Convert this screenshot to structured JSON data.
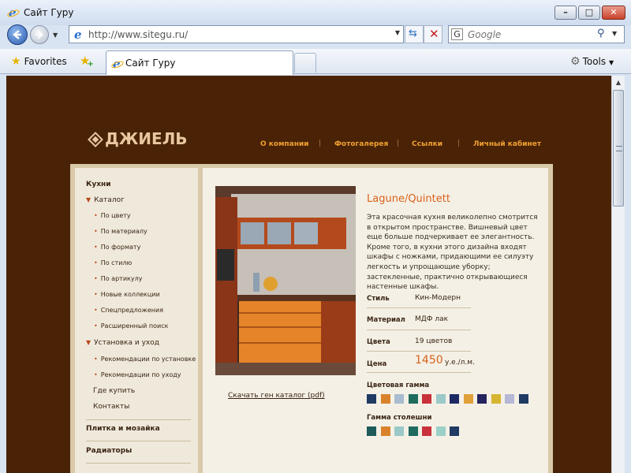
{
  "window": {
    "title": "Сайт Гуру"
  },
  "navigation": {
    "address": "http://www.sitegu.ru/",
    "search_placeholder": "Google",
    "search_engine_letter": "G"
  },
  "toolbar": {
    "favorites_label": "Favorites",
    "tab_title": "Сайт Гуру",
    "tools_label": "Tools"
  },
  "site": {
    "logo_text": "ДЖИЕЛЬ",
    "top_nav": [
      "О компании",
      "Фотогалерея",
      "Ссылки",
      "Личный кабинет"
    ]
  },
  "sidebar": {
    "section_title": "Кухни",
    "catalog_label": "Каталог",
    "catalog_items": [
      "По цвету",
      "По материалу",
      "По формату",
      "По стилю",
      "По артикулу",
      "Новые коллекции",
      "Спецпредложения",
      "Расширенный поиск"
    ],
    "install_label": "Установка и уход",
    "install_items": [
      "Рекомендации по установке",
      "Рекомендации по уходу"
    ],
    "plain_items": [
      "Где купить",
      "Контакты"
    ],
    "other_sections": [
      "Плитка и мозайка",
      "Радиаторы"
    ]
  },
  "product": {
    "title": "Lagune/Quintett",
    "description": "Эта красочная кухня великолепно смотрится в открытом пространстве. Вишневый цвет еще больше подчеркивает ее элегантность. Кроме того, в кухни этого дизайна входят шкафы с ножками, придающими ее силуэту легкость и упрощающие уборку; застекленные, практично открывающиеся настенные шкафы.",
    "specs": [
      {
        "label": "Стиль",
        "value": "Кин-Модерн"
      },
      {
        "label": "Материал",
        "value": "МДФ лак"
      },
      {
        "label": "Цвета",
        "value": "19 цветов"
      }
    ],
    "price_label": "Цена",
    "price_value": "1450",
    "price_unit": "у.е./л.м.",
    "catalog_link": "Скачать ген каталог (pdf)",
    "color_range_label": "Цветовая гамма",
    "color_range": [
      "#1f3a63",
      "#d9822b",
      "#a9bcd0",
      "#1f6b5e",
      "#c9323a",
      "#9bc9c8",
      "#1e2a66",
      "#e0a03a",
      "#25245e",
      "#d6b531",
      "#b7b7d6",
      "#1f3a63"
    ],
    "countertop_label": "Гамма столешни",
    "countertop_range": [
      "#1e5a5a",
      "#d9822b",
      "#9bc9c8",
      "#1f6b5e",
      "#c9323a",
      "#9bd0c8",
      "#1f3a63"
    ]
  }
}
